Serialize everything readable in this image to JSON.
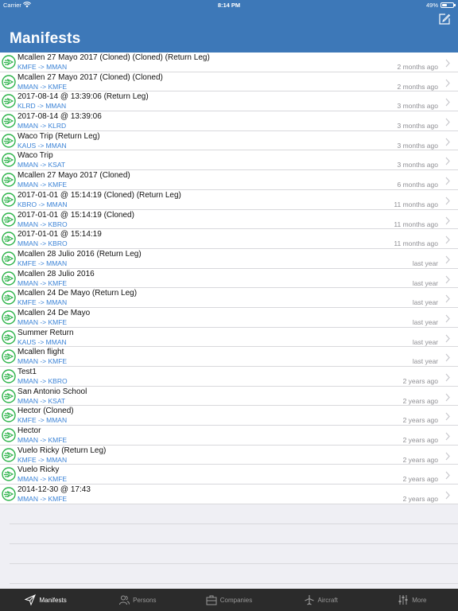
{
  "status_bar": {
    "carrier": "Carrier",
    "time": "8:14 PM",
    "battery": "49%",
    "battery_level": 0.49
  },
  "header": {
    "title": "Manifests",
    "compose_icon": "compose-icon"
  },
  "manifests": [
    {
      "title": "Mcallen 27 Mayo 2017 (Cloned) (Cloned) (Return Leg)",
      "route": "KMFE -> MMAN",
      "time": "2 months ago"
    },
    {
      "title": "Mcallen 27 Mayo 2017 (Cloned) (Cloned)",
      "route": "MMAN -> KMFE",
      "time": "2 months ago"
    },
    {
      "title": "2017-08-14 @ 13:39:06 (Return Leg)",
      "route": "KLRD -> MMAN",
      "time": "3 months ago"
    },
    {
      "title": "2017-08-14 @ 13:39:06",
      "route": "MMAN -> KLRD",
      "time": "3 months ago"
    },
    {
      "title": "Waco Trip (Return Leg)",
      "route": "KAUS -> MMAN",
      "time": "3 months ago"
    },
    {
      "title": "Waco Trip",
      "route": "MMAN -> KSAT",
      "time": "3 months ago"
    },
    {
      "title": "Mcallen 27 Mayo 2017 (Cloned)",
      "route": "MMAN -> KMFE",
      "time": "6 months ago"
    },
    {
      "title": "2017-01-01 @ 15:14:19 (Cloned) (Return Leg)",
      "route": "KBRO -> MMAN",
      "time": "11 months ago"
    },
    {
      "title": "2017-01-01 @ 15:14:19 (Cloned)",
      "route": "MMAN -> KBRO",
      "time": "11 months ago"
    },
    {
      "title": "2017-01-01 @ 15:14:19",
      "route": "MMAN -> KBRO",
      "time": "11 months ago"
    },
    {
      "title": "Mcallen 28 Julio 2016 (Return Leg)",
      "route": "KMFE -> MMAN",
      "time": "last year"
    },
    {
      "title": "Mcallen 28 Julio 2016",
      "route": "MMAN -> KMFE",
      "time": "last year"
    },
    {
      "title": "Mcallen 24 De Mayo (Return Leg)",
      "route": "KMFE -> MMAN",
      "time": "last year"
    },
    {
      "title": "Mcallen 24 De Mayo",
      "route": "MMAN -> KMFE",
      "time": "last year"
    },
    {
      "title": "Summer Return",
      "route": "KAUS -> MMAN",
      "time": "last year"
    },
    {
      "title": "Mcallen flight",
      "route": "MMAN -> KMFE",
      "time": "last year"
    },
    {
      "title": "Test1",
      "route": "MMAN -> KBRO",
      "time": "2 years ago"
    },
    {
      "title": "San Antonio School",
      "route": "MMAN -> KSAT",
      "time": "2 years ago"
    },
    {
      "title": "Hector (Cloned)",
      "route": "KMFE -> MMAN",
      "time": "2 years ago"
    },
    {
      "title": "Hector",
      "route": "MMAN -> KMFE",
      "time": "2 years ago"
    },
    {
      "title": "Vuelo Ricky (Return Leg)",
      "route": "KMFE -> MMAN",
      "time": "2 years ago"
    },
    {
      "title": "Vuelo Ricky",
      "route": "MMAN -> KMFE",
      "time": "2 years ago"
    },
    {
      "title": "2014-12-30 @ 17:43",
      "route": "MMAN -> KMFE",
      "time": "2 years ago"
    }
  ],
  "tabbar": {
    "tabs": [
      {
        "label": "Manifests",
        "icon": "paper-plane-icon",
        "active": true
      },
      {
        "label": "Persons",
        "icon": "persons-icon",
        "active": false
      },
      {
        "label": "Companies",
        "icon": "briefcase-icon",
        "active": false
      },
      {
        "label": "Aircraft",
        "icon": "airplane-icon",
        "active": false
      },
      {
        "label": "More",
        "icon": "sliders-icon",
        "active": false
      }
    ]
  },
  "colors": {
    "header": "#3d78b8",
    "route": "#3a82d6",
    "icon_green": "#2db34a",
    "tabbar": "#2b2b2b"
  }
}
